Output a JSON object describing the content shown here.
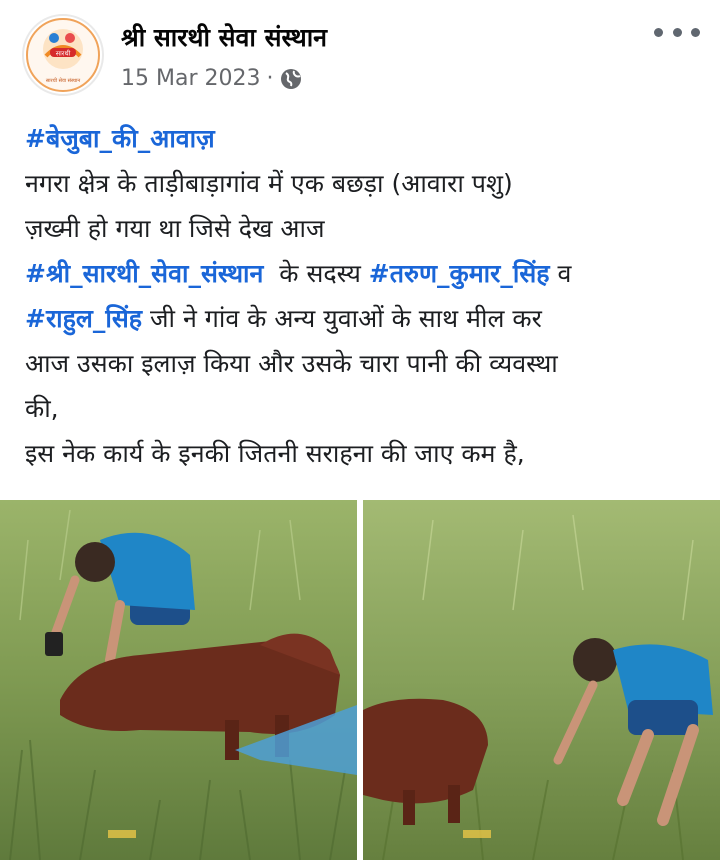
{
  "post": {
    "page_name": "श्री सारथी सेवा संस्थान",
    "date": "15 Mar 2023",
    "separator": "·",
    "privacy_icon": "globe-icon",
    "menu_icon": "more-options-icon",
    "logo_text": "सारथी",
    "logo_caption": "सारथी सेवा संस्थान"
  },
  "body": {
    "hashtag_title": "#बेजुबा_की_आवाज़",
    "line2": "नगरा क्षेत्र के ताड़ीबाड़ागांव में एक बछड़ा (आवारा पशु)",
    "line3": "ज़ख्मी हो गया था जिसे देख आज",
    "hashtag_org": "#श्री_सारथी_सेवा_संस्थान",
    "line4_mid": "  के सदस्य ",
    "hashtag_member1": "#तरुण_कुमार_सिंह",
    "line4_end": " व",
    "hashtag_member2": "#राहुल_सिंह",
    "line5_end": " जी ने गांव के अन्य युवाओं के साथ मील कर",
    "line6": "आज उसका इलाज़ किया और उसके चारा पानी की व्यवस्था",
    "line7": "की,",
    "line8": "इस नेक कार्य के इनकी जितनी सराहना की जाए कम है,"
  },
  "photos": [
    {
      "name": "photo-left"
    },
    {
      "name": "photo-right"
    }
  ],
  "colors": {
    "hashtag": "#1a66d8",
    "meta": "#65676b",
    "grass": "#7a9a4e",
    "shirt": "#1f86c7",
    "calf": "#6b2c1c"
  }
}
